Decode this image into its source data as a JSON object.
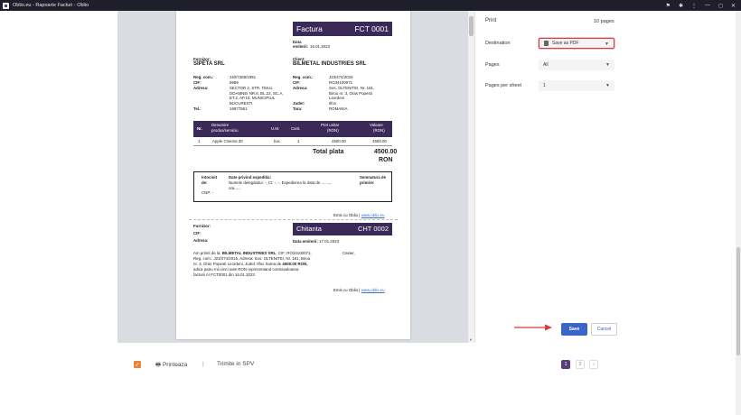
{
  "window": {
    "title": "Oblio.eu - Rapoarte Facturi - Oblio",
    "controls": [
      "⚑",
      "✱",
      "⋮",
      "—",
      "◻",
      "✕"
    ]
  },
  "invoice": {
    "title": "Factura",
    "number": "FCT 0001",
    "date_label": "Data",
    "date_label2": "emiterii:",
    "date_value": "16.01.2023",
    "supplier_label": "Furnizor:",
    "supplier_name": "SIPETA SRL",
    "client_label": "Client:",
    "client_name": "BILMETAL INDUSTRIES SRL",
    "s_reg_label": "Reg. com.:",
    "s_reg": "J40/7268/1991",
    "s_cif_label": "CIF:",
    "s_cif": "9689",
    "s_addr_label": "Adresa:",
    "s_addr1": "SECTOR 2, STR. TEIUL",
    "s_addr2": "DOAMNEI NR.6, BL.22, SC.A,",
    "s_addr3": "ET.2, AP.10, MUNICIPIUL",
    "s_addr4": "BUCURESTI",
    "s_tel_label": "Tel.:",
    "s_tel": "16877561",
    "c_reg_label": "Reg. com.:",
    "c_reg": "J23/474/2015",
    "c_cif_label": "CIF:",
    "c_cif": "RO34100071",
    "c_addr_label": "Adresa:",
    "c_addr1": "Sos. OLTENITEI, Nr. 181,",
    "c_addr2": "Birou nr. 3, Oras Popesti",
    "c_addr3": "Leordeni",
    "c_county_label": "Judet:",
    "c_county": "Ilfov",
    "c_country_label": "Tara:",
    "c_country": "ROMANIA",
    "columns": [
      "Nr.",
      "Denumire",
      "produs/serviciu",
      "U.M.",
      "Cant.",
      "Pret unitar",
      "(RON)",
      "Valoare",
      "(RON)"
    ],
    "rows": [
      {
        "nr": "1",
        "name": "Apple Cinema 30",
        "um": "buc",
        "qty": "1",
        "price": "4500.00",
        "value": "4500.00"
      }
    ],
    "total_label": "Total plata",
    "total_value": "4500.00",
    "total_currency": "RON",
    "box_issued": "Intocmit",
    "box_issued2": "de:",
    "box_cnp": "CNP: -",
    "box_shipping": "Date privind expeditia:",
    "box_shipping_text1": "Numele delegatului: -, CI: -, -. Expedierea la data de ........,",
    "box_shipping_text2": "ora .....",
    "box_sign": "Semnatura de",
    "box_sign2": "primire:",
    "footer_prefix": "Emis cu Oblio |",
    "footer_link": "www.oblio.eu"
  },
  "receipt": {
    "supplier_label": "Furnizor:",
    "cif_label": "CIF:",
    "addr_label": "Adresa:",
    "title": "Chitanta",
    "number": "CHT 0002",
    "date_label": "Data emiterii:",
    "date_value": "17.01.2023",
    "text1a": "Am primit de la:",
    "text1b": "BILMETAL INDUSTRIES SRL",
    "text1c": ", CIF: RO34100071,",
    "text2": "Reg. com.: J23/474/2015, Adresa: Sos. OLTENITEI, Nr. 181, Birou",
    "text3a": "nr. 3, Oras Popesti Leordeni, Judet: Ilfov Suma de",
    "text3b": "4500.00 RON,",
    "text4": "adica patru mii cinci sute RON reprezentand contravaloarea",
    "text5": "facturii nr FCT0001 din 16.01.2023",
    "cashier": "Casier,",
    "footer_prefix": "Emis cu Oblio |",
    "footer_link": "www.oblio.eu"
  },
  "print_settings": {
    "title": "Print",
    "pages_count": "10 pages",
    "destination_label": "Destination",
    "destination_value": "Save as PDF",
    "pages_label": "Pages",
    "pages_value": "All",
    "pages_per_sheet_label": "Pages per sheet",
    "pages_per_sheet_value": "1",
    "save_label": "Save",
    "cancel_label": "Cancel"
  },
  "toolbar": {
    "print_label": "Printeaza",
    "divider": "|",
    "spv_label": "Trimite in SPV"
  },
  "pagination": {
    "pages": [
      "1",
      "2",
      "›"
    ],
    "active": "1"
  },
  "colors": {
    "invoice_header": "#3b2a58",
    "accent_orange": "#e8833a",
    "save_blue": "#3a64c6",
    "highlight_red": "#d93a3a"
  }
}
